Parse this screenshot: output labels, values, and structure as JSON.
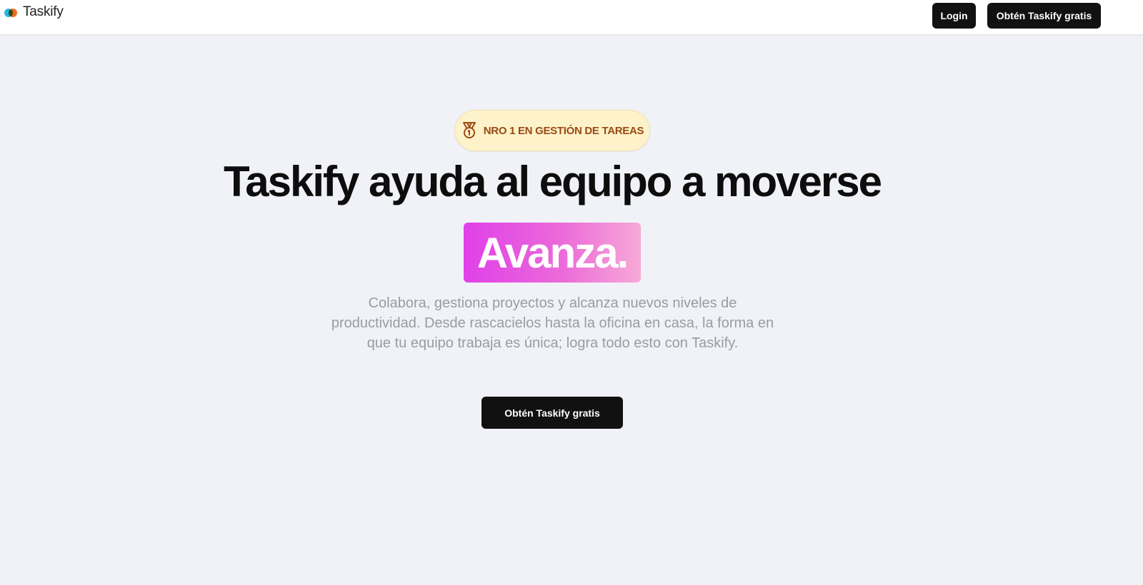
{
  "navbar": {
    "brand_name": "Taskify",
    "logo_icon": "taskify-logo-icon",
    "login_label": "Login",
    "get_label": "Obtén Taskify gratis"
  },
  "hero": {
    "badge_icon": "medal-icon",
    "badge_text": "NRO 1 EN GESTIÓN DE TAREAS",
    "headline": "Taskify ayuda al equipo a moverse",
    "highlight": "Avanza.",
    "subtext": "Colabora, gestiona proyectos y alcanza nuevos niveles de productividad. Desde rascacielos hasta la oficina en casa, la forma en que tu equipo trabaja es única; logra todo esto con Taskify.",
    "cta_label": "Obtén Taskify gratis"
  },
  "colors": {
    "background": "#f0f2f7",
    "button": "#111111",
    "badge_bg": "#fdf2c9",
    "badge_text": "#9a4a14",
    "gradient_start": "#e040e8",
    "gradient_end": "#f7a9d7"
  }
}
